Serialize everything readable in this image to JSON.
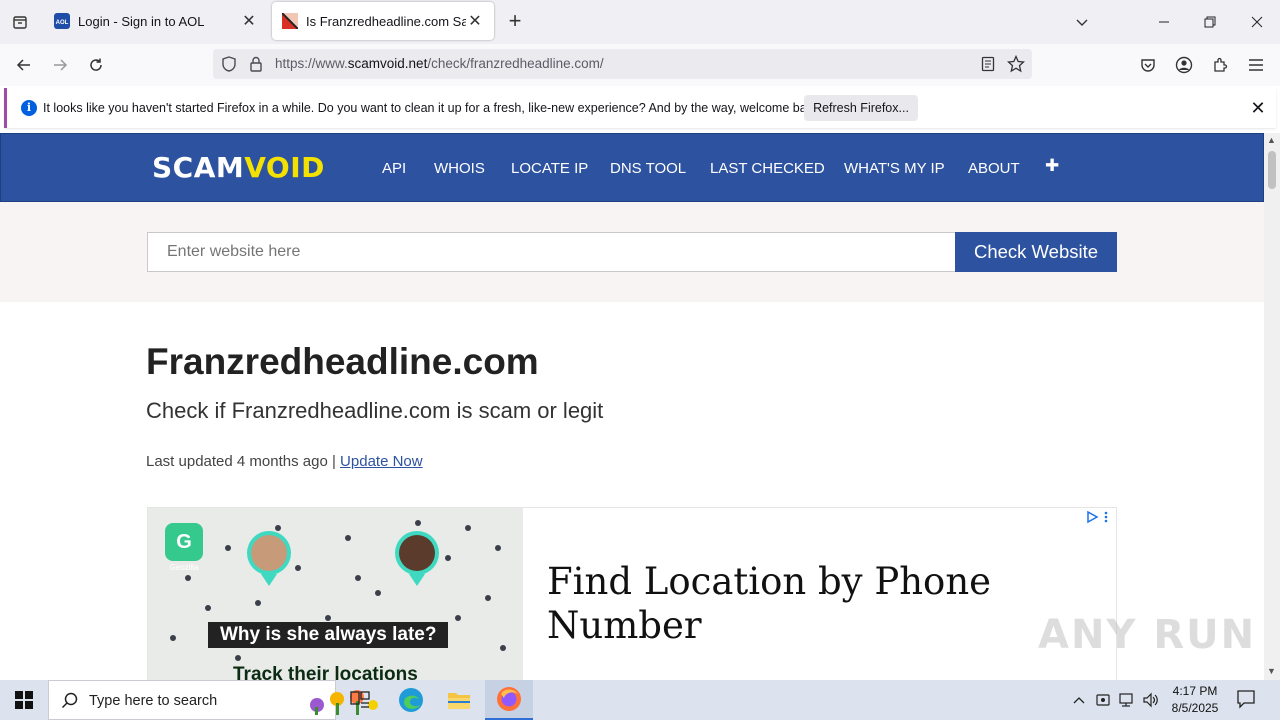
{
  "browser": {
    "tabs": [
      {
        "title": "Login - Sign in to AOL",
        "favicon": "aol-favicon",
        "active": false
      },
      {
        "title": "Is Franzredheadline.com Safe ?",
        "favicon": "scamvoid-favicon",
        "active": true
      }
    ],
    "url": {
      "prefix": "https://www.",
      "host": "scamvoid.net",
      "path": "/check/franzredheadline.com/"
    },
    "notification": {
      "message": "It looks like you haven't started Firefox in a while. Do you want to clean it up for a fresh, like-new experience? And by the way, welcome back!",
      "button_label": "Refresh Firefox..."
    }
  },
  "site": {
    "logo": {
      "part1": "SCAM",
      "part2": "VOID"
    },
    "nav": [
      "API",
      "WHOIS",
      "LOCATE IP",
      "DNS TOOL",
      "LAST CHECKED",
      "WHAT'S MY IP",
      "ABOUT"
    ],
    "nav_more": "✚",
    "search": {
      "placeholder": "Enter website here",
      "button_label": "Check Website"
    },
    "title": "Franzredheadline.com",
    "subtitle": "Check if Franzredheadline.com is scam or legit",
    "updated_text": "Last updated 4 months ago |",
    "update_link": "Update Now",
    "ad": {
      "caption": "Why is she always late?",
      "caption2": "Track their locations",
      "brand": "Geozilla",
      "headline": "Find Location by Phone Number"
    }
  },
  "watermark": "ANY RUN",
  "taskbar": {
    "search_placeholder": "Type here to search",
    "time": "4:17 PM",
    "date": "8/5/2025"
  },
  "colors": {
    "site_blue": "#2d52a0",
    "logo_yellow": "#f4e100",
    "notification_accent": "#a04ba8"
  }
}
